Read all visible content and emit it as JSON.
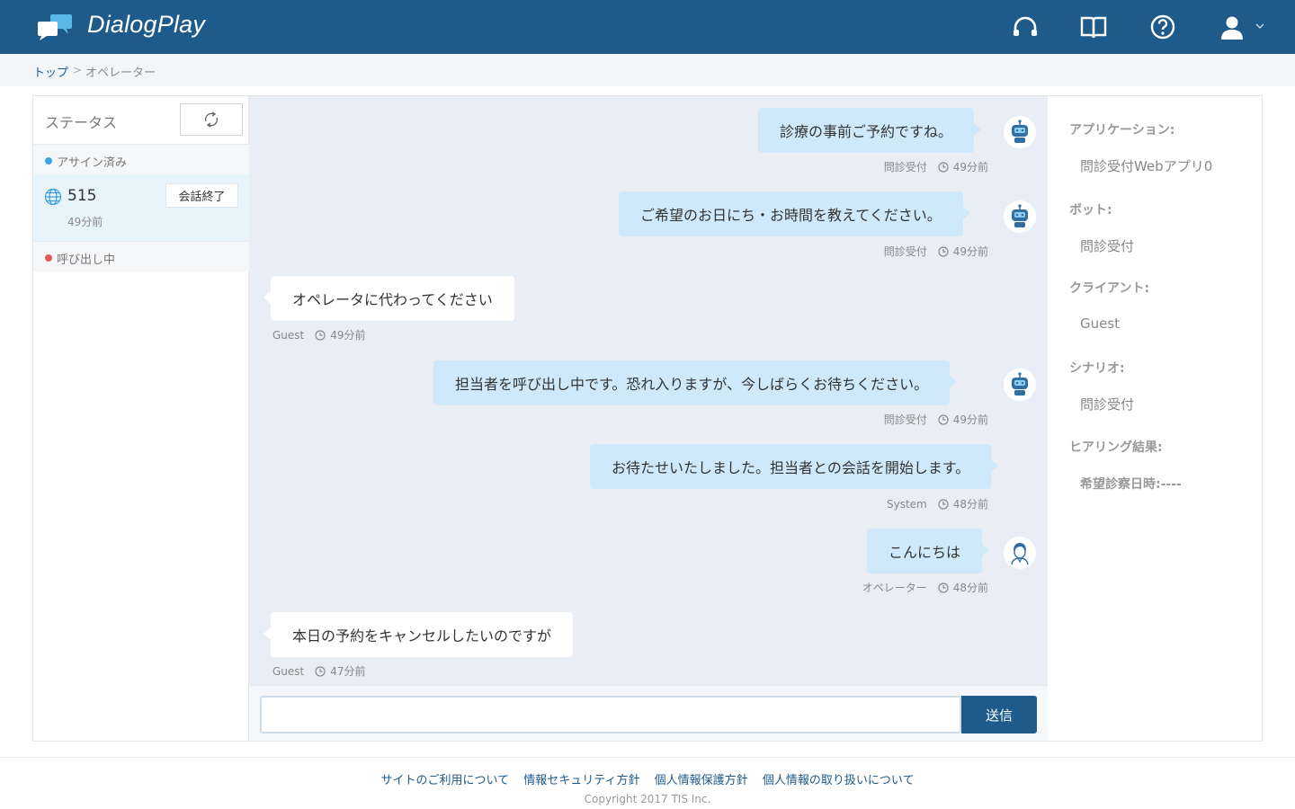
{
  "header": {
    "brand": "DialogPlay",
    "icons": [
      "headset-icon",
      "book-icon",
      "help-icon",
      "user-icon"
    ],
    "brand_color": "#1e5a8a"
  },
  "breadcrumb": {
    "top": "トップ",
    "separator": ">",
    "current": "オペレーター"
  },
  "sidebar": {
    "status_title": "ステータス",
    "assigned_label": "アサイン済み",
    "assigned_color": "#3aa3e3",
    "conversation": {
      "id": "515",
      "time": "49分前",
      "end_label": "会話終了"
    },
    "calling_label": "呼び出し中",
    "calling_color": "#e05a5a"
  },
  "chat": {
    "messages": [
      {
        "text": "診療の事前ご予約ですね。",
        "sender": "問診受付",
        "time": "49分前"
      },
      {
        "text": "ご希望のお日にち・お時間を教えてください。",
        "sender": "問診受付",
        "time": "49分前"
      },
      {
        "text": "オペレータに代わってください",
        "sender": "Guest",
        "time": "49分前"
      },
      {
        "text": "担当者を呼び出し中です。恐れ入りますが、今しばらくお待ちください。",
        "sender": "問診受付",
        "time": "49分前"
      },
      {
        "text": "お待たせいたしました。担当者との会話を開始します。",
        "sender": "System",
        "time": "48分前"
      },
      {
        "text": "こんにちは",
        "sender": "オペレーター",
        "time": "48分前"
      },
      {
        "text": "本日の予約をキャンセルしたいのですが",
        "sender": "Guest",
        "time": "47分前"
      }
    ],
    "input_value": "",
    "send_label": "送信"
  },
  "details": {
    "application_label": "アプリケーション:",
    "application_value": "問診受付Webアプリ0",
    "bot_label": "ボット:",
    "bot_value": "問診受付",
    "client_label": "クライアント:",
    "client_value": "Guest",
    "scenario_label": "シナリオ:",
    "scenario_value": "問診受付",
    "hearing_label": "ヒアリング結果:",
    "hearing_value": "希望診察日時:----"
  },
  "footer": {
    "links": [
      "サイトのご利用について",
      "情報セキュリティ方針",
      "個人情報保護方針",
      "個人情報の取り扱いについて"
    ],
    "copyright": "Copyright 2017 TIS Inc."
  }
}
